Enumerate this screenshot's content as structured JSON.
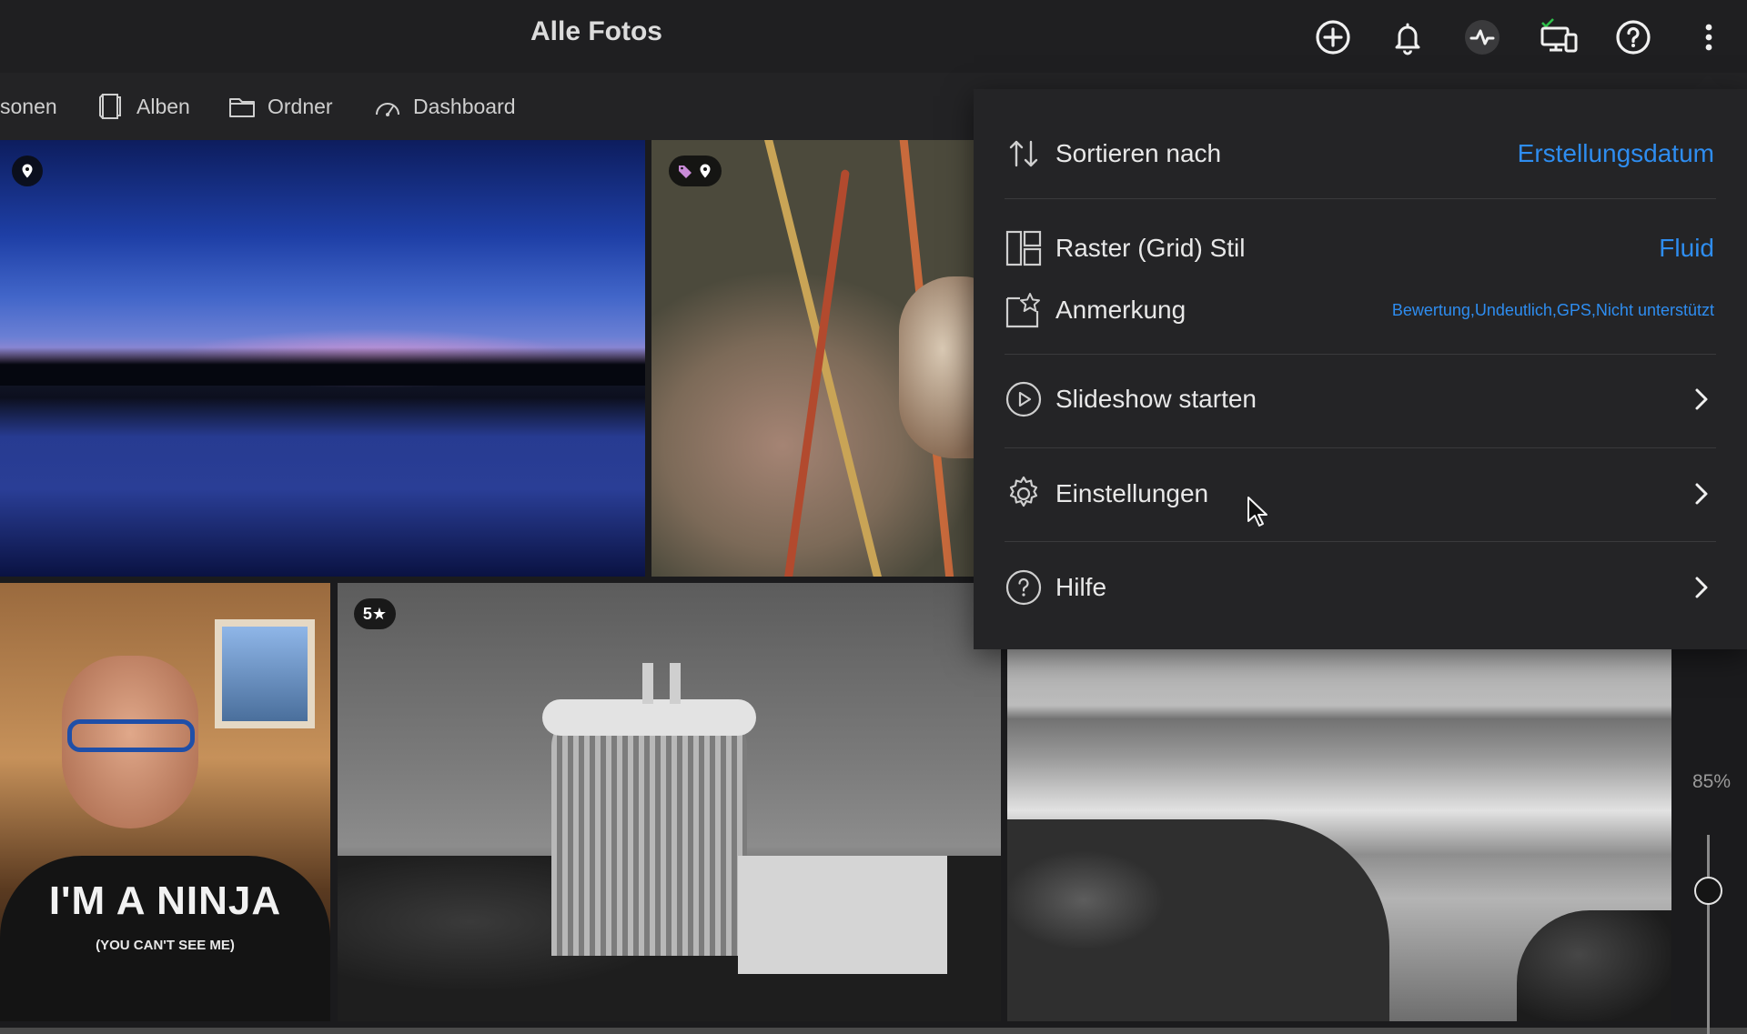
{
  "header": {
    "title": "Alle Fotos"
  },
  "toolbar": {
    "icons": [
      "add-circle-icon",
      "bell-icon",
      "activity-icon",
      "devices-icon",
      "help-circle-icon",
      "more-vertical-icon"
    ],
    "sync_check_color": "#2fbf4a"
  },
  "nav": {
    "items": [
      {
        "label": "sonen",
        "icon": ""
      },
      {
        "label": "Alben",
        "icon": "album-icon"
      },
      {
        "label": "Ordner",
        "icon": "folder-icon"
      },
      {
        "label": "Dashboard",
        "icon": "dashboard-gauge-icon"
      }
    ]
  },
  "photos": {
    "badges": {
      "location": "",
      "tag_location": "",
      "rating": "5★"
    },
    "shirt_line1": "I'M A NINJA",
    "shirt_line2": "(YOU CAN'T SEE ME)"
  },
  "zoom": {
    "label": "85%",
    "level_percent": 85
  },
  "menu": {
    "sort": {
      "label": "Sortieren nach",
      "value": "Erstellungsdatum"
    },
    "grid": {
      "label": "Raster (Grid) Stil",
      "value": "Fluid"
    },
    "annotation": {
      "label": "Anmerkung",
      "value": "Bewertung,Undeutlich,GPS,Nicht unterstützt"
    },
    "slideshow": {
      "label": "Slideshow starten"
    },
    "settings": {
      "label": "Einstellungen"
    },
    "help": {
      "label": "Hilfe"
    }
  },
  "colors": {
    "accent": "#2e8df0",
    "menu_bg": "#242426",
    "topbar_bg": "#1f1f21"
  }
}
